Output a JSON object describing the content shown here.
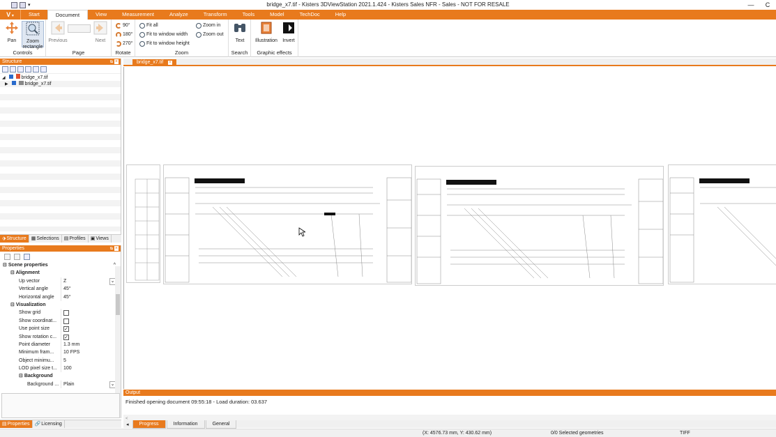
{
  "window": {
    "title": "bridge_x7.tif - Kisters 3DViewStation 2021.1.424 - Kisters Sales NFR - Sales - NOT FOR RESALE",
    "minimize": "—",
    "close": "C"
  },
  "app_menu": "V",
  "menus": [
    "Start",
    "Document",
    "View",
    "Measurement",
    "Analyze",
    "Transform",
    "Tools",
    "Model",
    "TechDoc",
    "Help"
  ],
  "ribbon": {
    "controls": {
      "label": "Controls",
      "pan": "Pan",
      "zoom_rect": "Zoom rectangle"
    },
    "page": {
      "label": "Page",
      "previous": "Previous",
      "next": "Next"
    },
    "rotate": {
      "label": "Rotate",
      "r90": "90°",
      "r180": "180°",
      "r270": "270°"
    },
    "zoom": {
      "label": "Zoom",
      "fit_all": "Fit all",
      "fit_width": "Fit to window width",
      "fit_height": "Fit to window height",
      "zoom_in": "Zoom in",
      "zoom_out": "Zoom out"
    },
    "search": {
      "label": "Search",
      "text": "Text"
    },
    "graphic": {
      "label": "Graphic effects",
      "illustration": "Illustration",
      "invert": "Invert"
    }
  },
  "structure": {
    "title": "Structure",
    "pin": "ᴓ",
    "close": "×",
    "items": [
      {
        "label": "bridge_x7.tif",
        "level": 0
      },
      {
        "label": "bridge_x7.tif",
        "level": 1
      }
    ],
    "tabs": [
      "Structure",
      "Selections",
      "Profiles",
      "Views"
    ]
  },
  "properties": {
    "title": "Properties",
    "pin": "ᴓ",
    "close": "×",
    "scene_properties": "Scene properties",
    "alignment": "Alignment",
    "up_vector_label": "Up vector",
    "up_vector_value": "Z",
    "vertical_angle_label": "Vertical angle",
    "vertical_angle_value": "45°",
    "horizontal_angle_label": "Horizontal angle",
    "horizontal_angle_value": "45°",
    "visualization": "Visualization",
    "show_grid": "Show grid",
    "show_coord": "Show coordinat...",
    "use_point_size": "Use point size",
    "show_rotation": "Show rotation c...",
    "point_diameter_label": "Point diameter",
    "point_diameter_value": "1.3 mm",
    "min_frame_label": "Minimum fram...",
    "min_frame_value": "10 FPS",
    "obj_min_label": "Object minimu...",
    "obj_min_value": "5",
    "lod_label": "LOD pixel size t...",
    "lod_value": "100",
    "background": "Background",
    "bg_label": "Background ...",
    "bg_value": "Plain",
    "checks": {
      "show_grid": false,
      "show_coord": false,
      "use_point_size": true,
      "show_rotation": true
    }
  },
  "left_bottom_tabs": [
    "Properties",
    "Licensing"
  ],
  "doc_tab": {
    "label": "bridge_x7.tif",
    "close": "×"
  },
  "output": {
    "title": "Output",
    "message": "Finished opening document 09:55:18 - Load duration: 03.637",
    "arrow": "<"
  },
  "bottom_tabs": [
    "Progress",
    "Information",
    "General"
  ],
  "status": {
    "coords": "(X: 4576.73 mm, Y: 430.62 mm)",
    "selected": "0/0 Selected geometries",
    "format": "TIFF"
  },
  "colors": {
    "accent": "#e87a1d"
  }
}
